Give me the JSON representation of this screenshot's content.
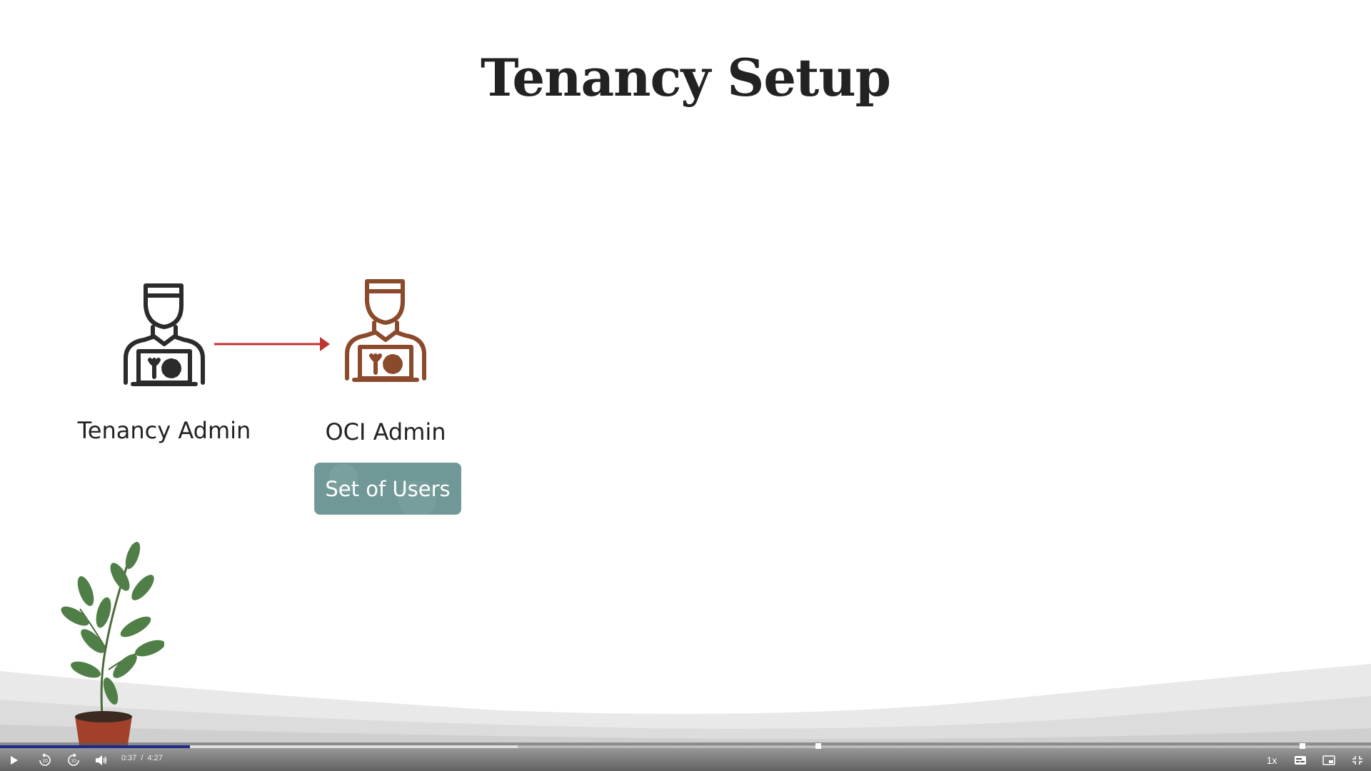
{
  "slide": {
    "title": "Tenancy Setup",
    "left_person_label": "Tenancy Admin",
    "right_person_label": "OCI Admin",
    "group_button_label": "Set of Users",
    "colors": {
      "title_text": "#222222",
      "left_icon": "#2b2b2b",
      "right_icon": "#8a4a2b",
      "arrow": "#c0342f",
      "group_button": "#6f9896"
    },
    "icons": [
      "user-admin-icon",
      "user-admin-icon",
      "arrow-right-icon",
      "plant-illustration"
    ]
  },
  "player": {
    "current_time": "0:37",
    "separator": "/",
    "duration": "4:27",
    "progress_fraction": 0.1386,
    "speed_label": "1x",
    "icons": [
      "play-icon",
      "rewind-10-icon",
      "forward-10-icon",
      "volume-icon",
      "captions-icon",
      "picture-in-picture-icon",
      "exit-fullscreen-icon"
    ]
  }
}
